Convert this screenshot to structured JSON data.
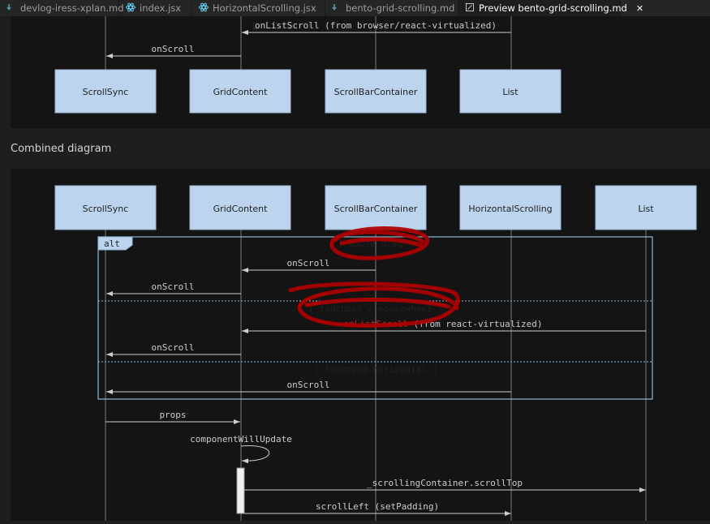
{
  "tabs": [
    {
      "label": "devlog-iress-xplan.md",
      "icon": "markdown-icon",
      "modified": true
    },
    {
      "label": "index.jsx",
      "icon": "react-icon"
    },
    {
      "label": "HorizontalScrolling.jsx",
      "icon": "react-icon"
    },
    {
      "label": "bento-grid-scrolling.md",
      "icon": "markdown-icon"
    },
    {
      "label": "Preview bento-grid-scrolling.md",
      "icon": "preview-icon",
      "active": true
    }
  ],
  "top_diagram": {
    "messages": {
      "on_list_scroll": "onListScroll (from browser/react-virtualized)",
      "on_scroll": "onScroll"
    },
    "actors": [
      "ScrollSync",
      "GridContent",
      "ScrollBarContainer",
      "List"
    ]
  },
  "section_heading": "Combined diagram",
  "combined_diagram": {
    "actors": [
      "ScrollSync",
      "GridContent",
      "ScrollBarContainer",
      "HorizontalScrolling",
      "List"
    ],
    "alt_label": "alt",
    "guards": {
      "mouse_drag": "[ mouse drag ]",
      "touchpad": "[ touchpad / mousewheel ]",
      "touchpad_horizontal": "[ touchpad-horizontal ]"
    },
    "messages": {
      "on_scroll_1": "onScroll",
      "on_scroll_2": "onScroll",
      "on_list_scroll": "onListScroll",
      "on_list_scroll_suffix": " (from react-virtualized)",
      "on_scroll_3": "onScroll",
      "on_scroll_4": "onScroll",
      "props": "props",
      "component_will_update": "componentWillUpdate",
      "scroll_top": "_scrollingContainer.scrollTop",
      "scroll_left": "scrollLeft (setPadding)"
    }
  },
  "colors": {
    "actor_fill": "#bcd4ee",
    "alt_border": "#8fb6d8",
    "annotation_red": "#cc0000",
    "highlight_red": "#cc2222"
  }
}
